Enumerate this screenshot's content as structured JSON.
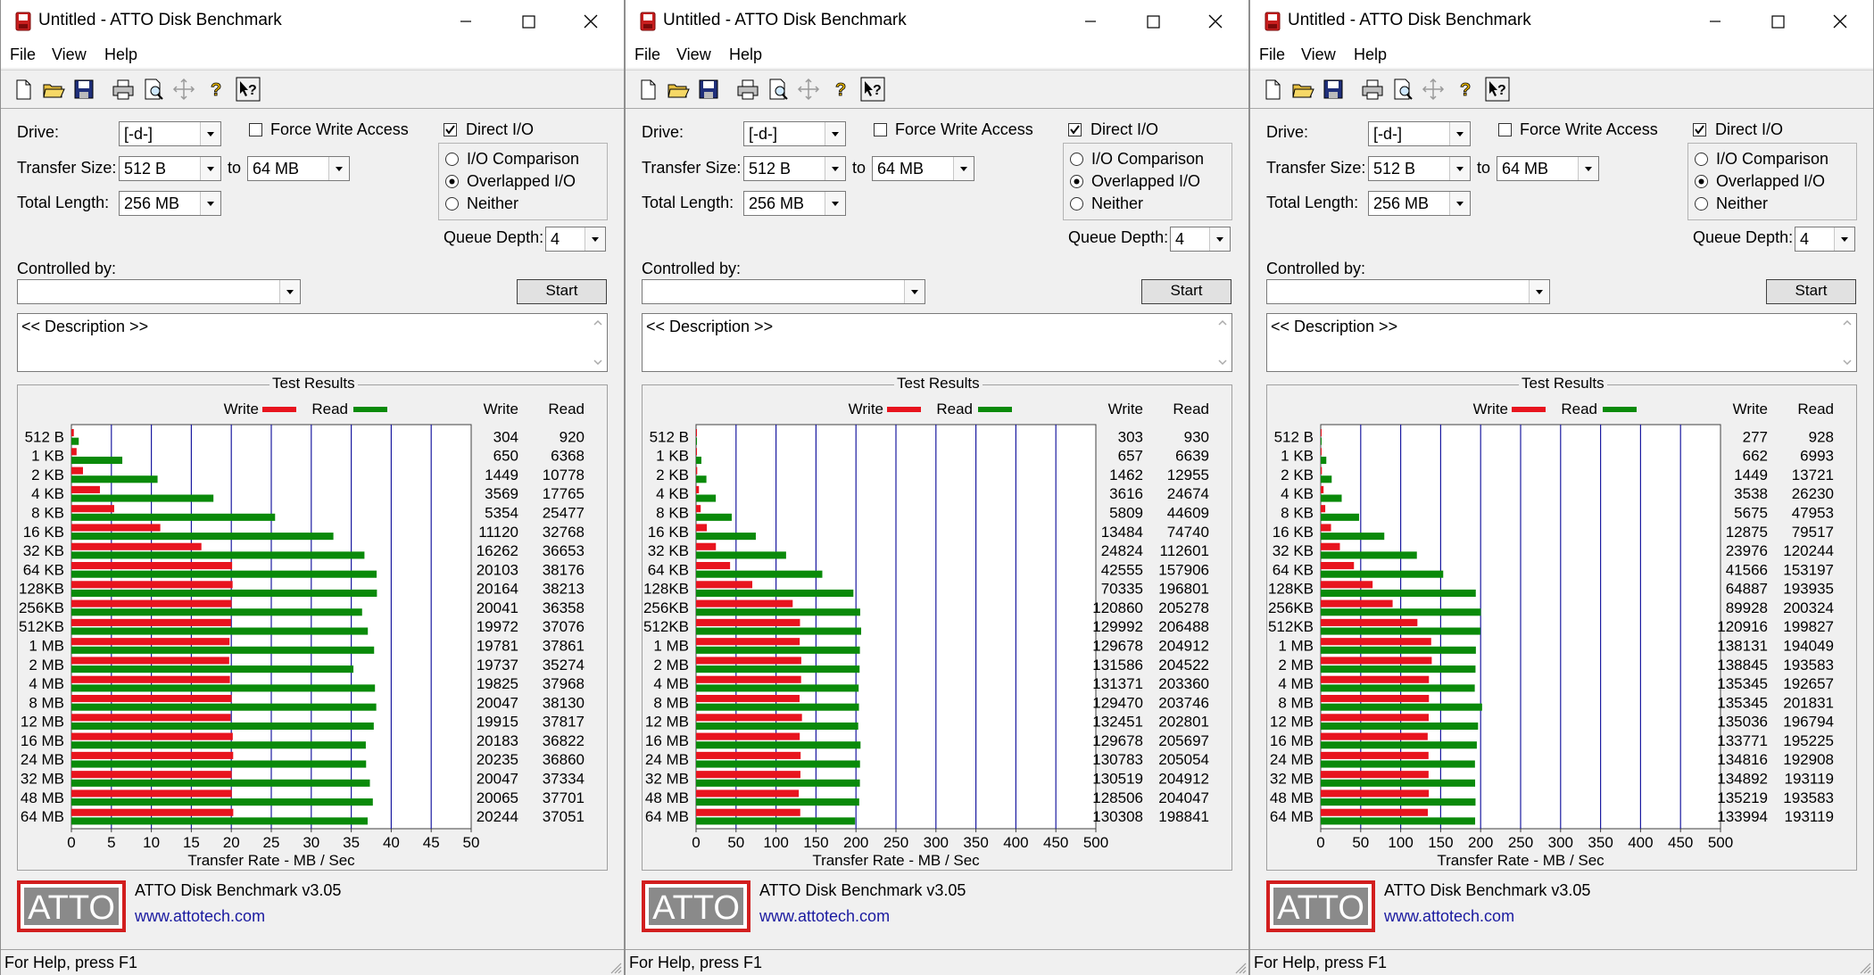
{
  "windows": [
    {
      "title": "Untitled - ATTO Disk Benchmark",
      "menu": [
        "File",
        "View",
        "Help"
      ],
      "toolbar_icons": [
        "new-file-icon",
        "open-folder-icon",
        "save-icon",
        "print-icon",
        "print-preview-icon",
        "move-icon",
        "help-icon",
        "context-help-icon"
      ],
      "labels": {
        "drive": "Drive:",
        "transfer_size": "Transfer Size:",
        "to": "to",
        "total_length": "Total Length:",
        "force_write_access": "Force Write Access",
        "direct_io": "Direct I/O",
        "io_comparison": "I/O Comparison",
        "overlapped_io": "Overlapped I/O",
        "neither": "Neither",
        "queue_depth": "Queue Depth:",
        "controlled_by": "Controlled by:",
        "start": "Start",
        "description": "<< Description >>",
        "test_results": "Test Results",
        "write": "Write",
        "read": "Read",
        "xlabel": "Transfer Rate - MB / Sec",
        "logo": "ATTO",
        "product": "ATTO Disk Benchmark v3.05",
        "url": "www.attotech.com",
        "status": "For Help, press F1"
      },
      "settings": {
        "drive": "[-d-]",
        "transfer_from": "512 B",
        "transfer_to": "64 MB",
        "total_length": "256 MB",
        "force_write_access": false,
        "direct_io": true,
        "io_mode": "overlapped",
        "queue_depth": "4",
        "controlled_by": ""
      },
      "colors": {
        "write": "#e8141e",
        "read": "#0a8a0a",
        "gridline": "#1a1aa0"
      },
      "chart_data": {
        "type": "bar",
        "orientation": "horizontal",
        "title": "Test Results",
        "xlabel": "Transfer Rate - MB / Sec",
        "xlim": [
          0,
          50
        ],
        "xticks": [
          0,
          5,
          10,
          15,
          20,
          25,
          30,
          35,
          40,
          45,
          50
        ],
        "categories": [
          "512 B",
          "1 KB",
          "2 KB",
          "4 KB",
          "8 KB",
          "16 KB",
          "32 KB",
          "64 KB",
          "128KB",
          "256KB",
          "512KB",
          "1 MB",
          "2 MB",
          "4 MB",
          "8 MB",
          "12 MB",
          "16 MB",
          "24 MB",
          "32 MB",
          "48 MB",
          "64 MB"
        ],
        "series": [
          {
            "name": "Write",
            "values": [
              304,
              650,
              1449,
              3569,
              5354,
              11120,
              16262,
              20103,
              20164,
              20041,
              19972,
              19781,
              19737,
              19825,
              20047,
              19915,
              20183,
              20235,
              20047,
              20065,
              20244
            ]
          },
          {
            "name": "Read",
            "values": [
              920,
              6368,
              10778,
              17765,
              25477,
              32768,
              36653,
              38176,
              38213,
              36358,
              37076,
              37861,
              35274,
              37968,
              38130,
              37817,
              36822,
              36860,
              37334,
              37701,
              37051
            ]
          }
        ],
        "value_unit_divisor": 1000
      }
    },
    {
      "title": "Untitled - ATTO Disk Benchmark",
      "menu": [
        "File",
        "View",
        "Help"
      ],
      "toolbar_icons": [
        "new-file-icon",
        "open-folder-icon",
        "save-icon",
        "print-icon",
        "print-preview-icon",
        "move-icon",
        "help-icon",
        "context-help-icon"
      ],
      "labels": {
        "drive": "Drive:",
        "transfer_size": "Transfer Size:",
        "to": "to",
        "total_length": "Total Length:",
        "force_write_access": "Force Write Access",
        "direct_io": "Direct I/O",
        "io_comparison": "I/O Comparison",
        "overlapped_io": "Overlapped I/O",
        "neither": "Neither",
        "queue_depth": "Queue Depth:",
        "controlled_by": "Controlled by:",
        "start": "Start",
        "description": "<< Description >>",
        "test_results": "Test Results",
        "write": "Write",
        "read": "Read",
        "xlabel": "Transfer Rate - MB / Sec",
        "logo": "ATTO",
        "product": "ATTO Disk Benchmark v3.05",
        "url": "www.attotech.com",
        "status": "For Help, press F1"
      },
      "settings": {
        "drive": "[-d-]",
        "transfer_from": "512 B",
        "transfer_to": "64 MB",
        "total_length": "256 MB",
        "force_write_access": false,
        "direct_io": true,
        "io_mode": "overlapped",
        "queue_depth": "4",
        "controlled_by": ""
      },
      "colors": {
        "write": "#e8141e",
        "read": "#0a8a0a",
        "gridline": "#1a1aa0"
      },
      "chart_data": {
        "type": "bar",
        "orientation": "horizontal",
        "title": "Test Results",
        "xlabel": "Transfer Rate - MB / Sec",
        "xlim": [
          0,
          500
        ],
        "xticks": [
          0,
          50,
          100,
          150,
          200,
          250,
          300,
          350,
          400,
          450,
          500
        ],
        "categories": [
          "512 B",
          "1 KB",
          "2 KB",
          "4 KB",
          "8 KB",
          "16 KB",
          "32 KB",
          "64 KB",
          "128KB",
          "256KB",
          "512KB",
          "1 MB",
          "2 MB",
          "4 MB",
          "8 MB",
          "12 MB",
          "16 MB",
          "24 MB",
          "32 MB",
          "48 MB",
          "64 MB"
        ],
        "series": [
          {
            "name": "Write",
            "values": [
              303,
              657,
              1462,
              3616,
              5809,
              13484,
              24824,
              42555,
              70335,
              120860,
              129992,
              129678,
              131586,
              131371,
              129470,
              132451,
              129678,
              130783,
              130519,
              128506,
              130308
            ]
          },
          {
            "name": "Read",
            "values": [
              930,
              6639,
              12955,
              24674,
              44609,
              74740,
              112601,
              157906,
              196801,
              205278,
              206488,
              204912,
              204522,
              203360,
              203746,
              202801,
              205697,
              205054,
              204912,
              204047,
              198841
            ]
          }
        ],
        "value_unit_divisor": 1000
      }
    },
    {
      "title": "Untitled - ATTO Disk Benchmark",
      "menu": [
        "File",
        "View",
        "Help"
      ],
      "toolbar_icons": [
        "new-file-icon",
        "open-folder-icon",
        "save-icon",
        "print-icon",
        "print-preview-icon",
        "move-icon",
        "help-icon",
        "context-help-icon"
      ],
      "labels": {
        "drive": "Drive:",
        "transfer_size": "Transfer Size:",
        "to": "to",
        "total_length": "Total Length:",
        "force_write_access": "Force Write Access",
        "direct_io": "Direct I/O",
        "io_comparison": "I/O Comparison",
        "overlapped_io": "Overlapped I/O",
        "neither": "Neither",
        "queue_depth": "Queue Depth:",
        "controlled_by": "Controlled by:",
        "start": "Start",
        "description": "<< Description >>",
        "test_results": "Test Results",
        "write": "Write",
        "read": "Read",
        "xlabel": "Transfer Rate - MB / Sec",
        "logo": "ATTO",
        "product": "ATTO Disk Benchmark v3.05",
        "url": "www.attotech.com",
        "status": "For Help, press F1"
      },
      "settings": {
        "drive": "[-d-]",
        "transfer_from": "512 B",
        "transfer_to": "64 MB",
        "total_length": "256 MB",
        "force_write_access": false,
        "direct_io": true,
        "io_mode": "overlapped",
        "queue_depth": "4",
        "controlled_by": ""
      },
      "colors": {
        "write": "#e8141e",
        "read": "#0a8a0a",
        "gridline": "#1a1aa0"
      },
      "chart_data": {
        "type": "bar",
        "orientation": "horizontal",
        "title": "Test Results",
        "xlabel": "Transfer Rate - MB / Sec",
        "xlim": [
          0,
          500
        ],
        "xticks": [
          0,
          50,
          100,
          150,
          200,
          250,
          300,
          350,
          400,
          450,
          500
        ],
        "categories": [
          "512 B",
          "1 KB",
          "2 KB",
          "4 KB",
          "8 KB",
          "16 KB",
          "32 KB",
          "64 KB",
          "128KB",
          "256KB",
          "512KB",
          "1 MB",
          "2 MB",
          "4 MB",
          "8 MB",
          "12 MB",
          "16 MB",
          "24 MB",
          "32 MB",
          "48 MB",
          "64 MB"
        ],
        "series": [
          {
            "name": "Write",
            "values": [
              277,
              662,
              1449,
              3538,
              5675,
              12875,
              23976,
              41566,
              64887,
              89928,
              120916,
              138131,
              138845,
              135345,
              135345,
              135036,
              133771,
              134816,
              134892,
              135219,
              133994
            ]
          },
          {
            "name": "Read",
            "values": [
              928,
              6993,
              13721,
              26230,
              47953,
              79517,
              120244,
              153197,
              193935,
              200324,
              199827,
              194049,
              193583,
              192657,
              201831,
              196794,
              195225,
              192908,
              193119,
              193583,
              193119
            ]
          }
        ],
        "value_unit_divisor": 1000
      }
    }
  ]
}
